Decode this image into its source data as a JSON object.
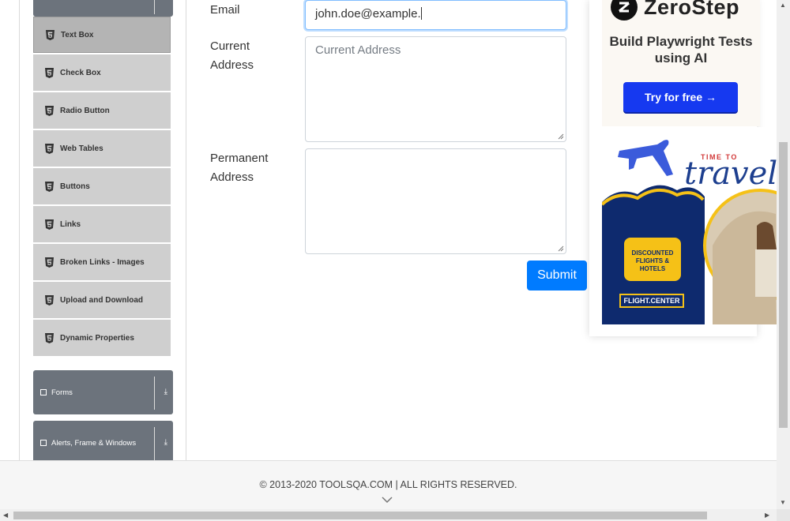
{
  "sidebar": {
    "items": [
      {
        "label": "Text Box",
        "active": true
      },
      {
        "label": "Check Box"
      },
      {
        "label": "Radio Button"
      },
      {
        "label": "Web Tables"
      },
      {
        "label": "Buttons"
      },
      {
        "label": "Links"
      },
      {
        "label": "Broken Links - Images"
      },
      {
        "label": "Upload and Download"
      },
      {
        "label": "Dynamic Properties"
      }
    ],
    "groups": [
      {
        "label": "Forms"
      },
      {
        "label": "Alerts, Frame & Windows"
      }
    ]
  },
  "form": {
    "email_label": "Email",
    "email_value": "john.doe@example.",
    "current_address_label": "Current Address",
    "current_address_placeholder": "Current Address",
    "permanent_address_label": "Permanent Address",
    "permanent_address_value": "",
    "submit_label": "Submit"
  },
  "ads": {
    "zerostep": {
      "brand": "ZeroStep",
      "headline": "Build Playwright Tests using AI",
      "cta": "Try for free →"
    },
    "travel": {
      "kicker": "TIME TO",
      "word": "travel",
      "bubble": "DISCOUNTED FLIGHTS & HOTELS",
      "badge": "FLIGHT.CENTER"
    }
  },
  "footer": {
    "copyright": "© 2013-2020 TOOLSQA.COM | ALL RIGHTS RESERVED."
  },
  "colors": {
    "primary": "#007bff",
    "sidebar_group": "#6c737c",
    "sidebar_item": "#cfcfcf",
    "ad_button": "#1639f0",
    "travel_blue": "#1d3f8f",
    "travel_yellow": "#f5c117"
  }
}
